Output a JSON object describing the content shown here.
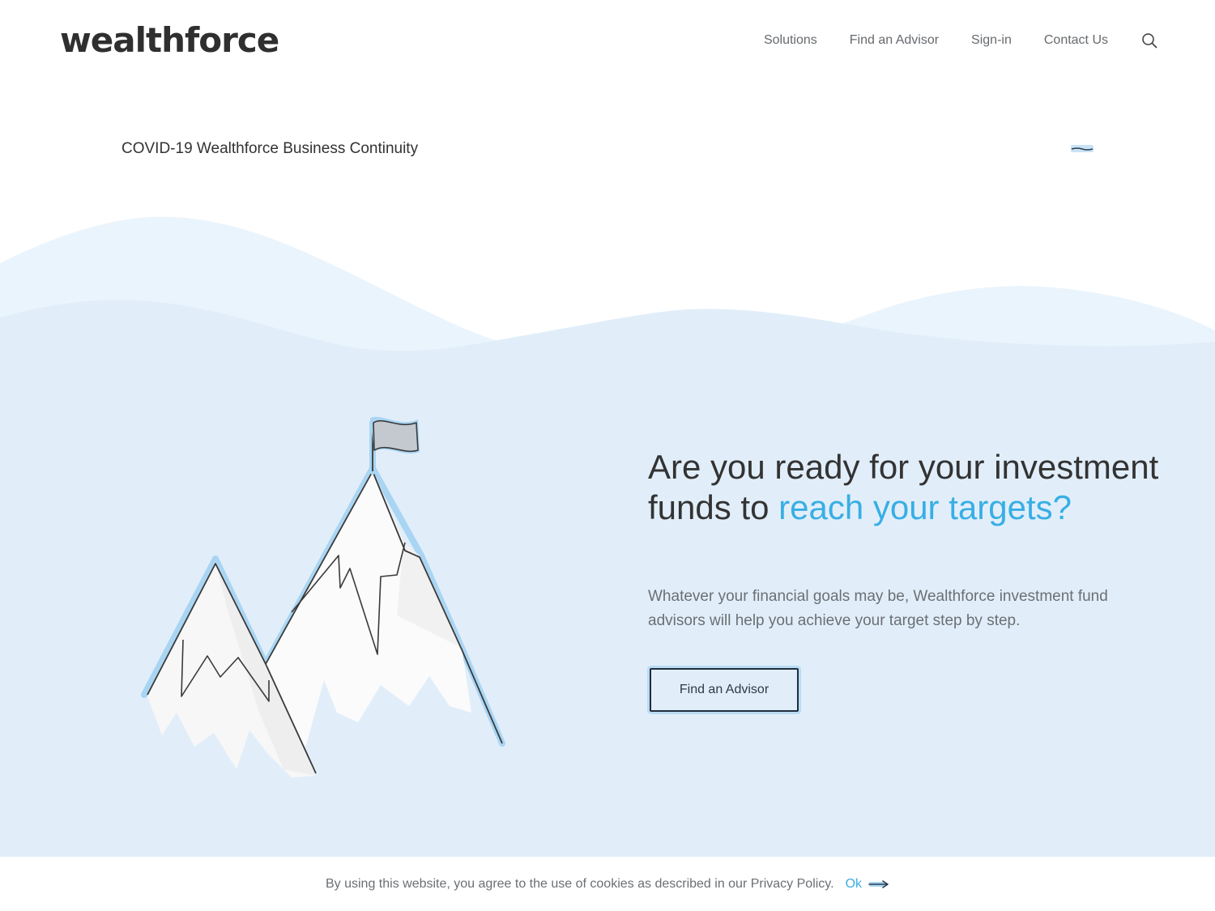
{
  "brand": {
    "logo_text": "wealthforce"
  },
  "nav": {
    "items": [
      {
        "label": "Solutions"
      },
      {
        "label": "Find an Advisor"
      },
      {
        "label": "Sign-in"
      },
      {
        "label": "Contact Us"
      }
    ],
    "search_icon": "search-icon"
  },
  "notice": {
    "label": "COVID-19 Wealthforce Business Continuity",
    "toggle_icon": "collapse-dash-icon"
  },
  "hero": {
    "title_part1": "Are you ready for your investment funds to ",
    "title_accent": "reach your targets?",
    "description": "Whatever your financial goals may be, Wealthforce investment fund advisors will help you achieve your target step by step.",
    "cta_label": "Find an Advisor",
    "illustration_icon": "mountain-flag-illustration"
  },
  "cookie": {
    "text": "By using this website, you agree to the use of cookies as described in our Privacy Policy.",
    "ok_label": "Ok",
    "ok_icon": "arrow-right-icon"
  },
  "colors": {
    "accent": "#38aee4",
    "hero_bg": "#e1eefa",
    "wave_light": "#ebf4fc",
    "text_dark": "#333333",
    "text_muted": "#6b6f73"
  }
}
